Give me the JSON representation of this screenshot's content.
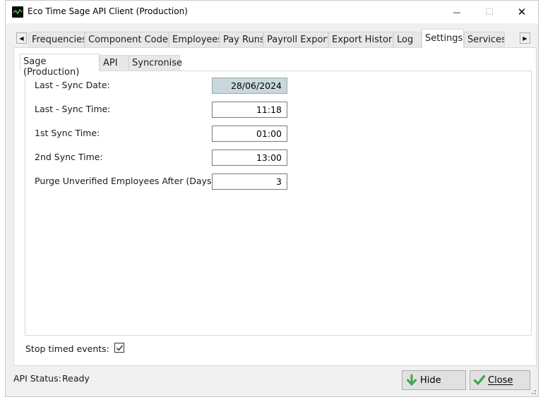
{
  "window": {
    "title": "Eco Time Sage API Client (Production)",
    "minimize_glyph": "—",
    "maximize_glyph": "☐",
    "close_glyph": "✕"
  },
  "tabs": [
    {
      "label": "Frequencies"
    },
    {
      "label": "Component Codes"
    },
    {
      "label": "Employees"
    },
    {
      "label": "Pay Runs"
    },
    {
      "label": "Payroll Export"
    },
    {
      "label": "Export History"
    },
    {
      "label": "Log"
    },
    {
      "label": "Settings",
      "active": true
    },
    {
      "label": "Services"
    }
  ],
  "tab_scroll": {
    "left_glyph": "◀",
    "right_glyph": "▶"
  },
  "subtabs": [
    {
      "label": "Sage (Production)",
      "active": true
    },
    {
      "label": "API"
    },
    {
      "label": "Syncronise"
    }
  ],
  "settings": {
    "last_sync_date": {
      "label": "Last - Sync Date:",
      "value": "28/06/2024",
      "readonly": true
    },
    "last_sync_time": {
      "label": "Last - Sync Time:",
      "value": "11:18"
    },
    "first_sync_time": {
      "label": "1st Sync Time:",
      "value": "01:00"
    },
    "second_sync_time": {
      "label": "2nd Sync Time:",
      "value": "13:00"
    },
    "purge_days": {
      "label": "Purge Unverified Employees After (Days):",
      "value": "3"
    }
  },
  "stop_timed_events": {
    "label": "Stop timed events:",
    "checked": true
  },
  "status": {
    "label": "API Status:",
    "value": "Ready"
  },
  "buttons": {
    "hide": {
      "label": "Hide",
      "icon": "arrow-down-icon",
      "color": "#3aa84a"
    },
    "close": {
      "label": "Close",
      "icon": "checkmark-icon",
      "color": "#3aa84a"
    }
  },
  "colors": {
    "readonly_field_bg": "#c9d8de",
    "window_bg": "#f0f0f0",
    "button_bg": "#e1e1e1"
  }
}
